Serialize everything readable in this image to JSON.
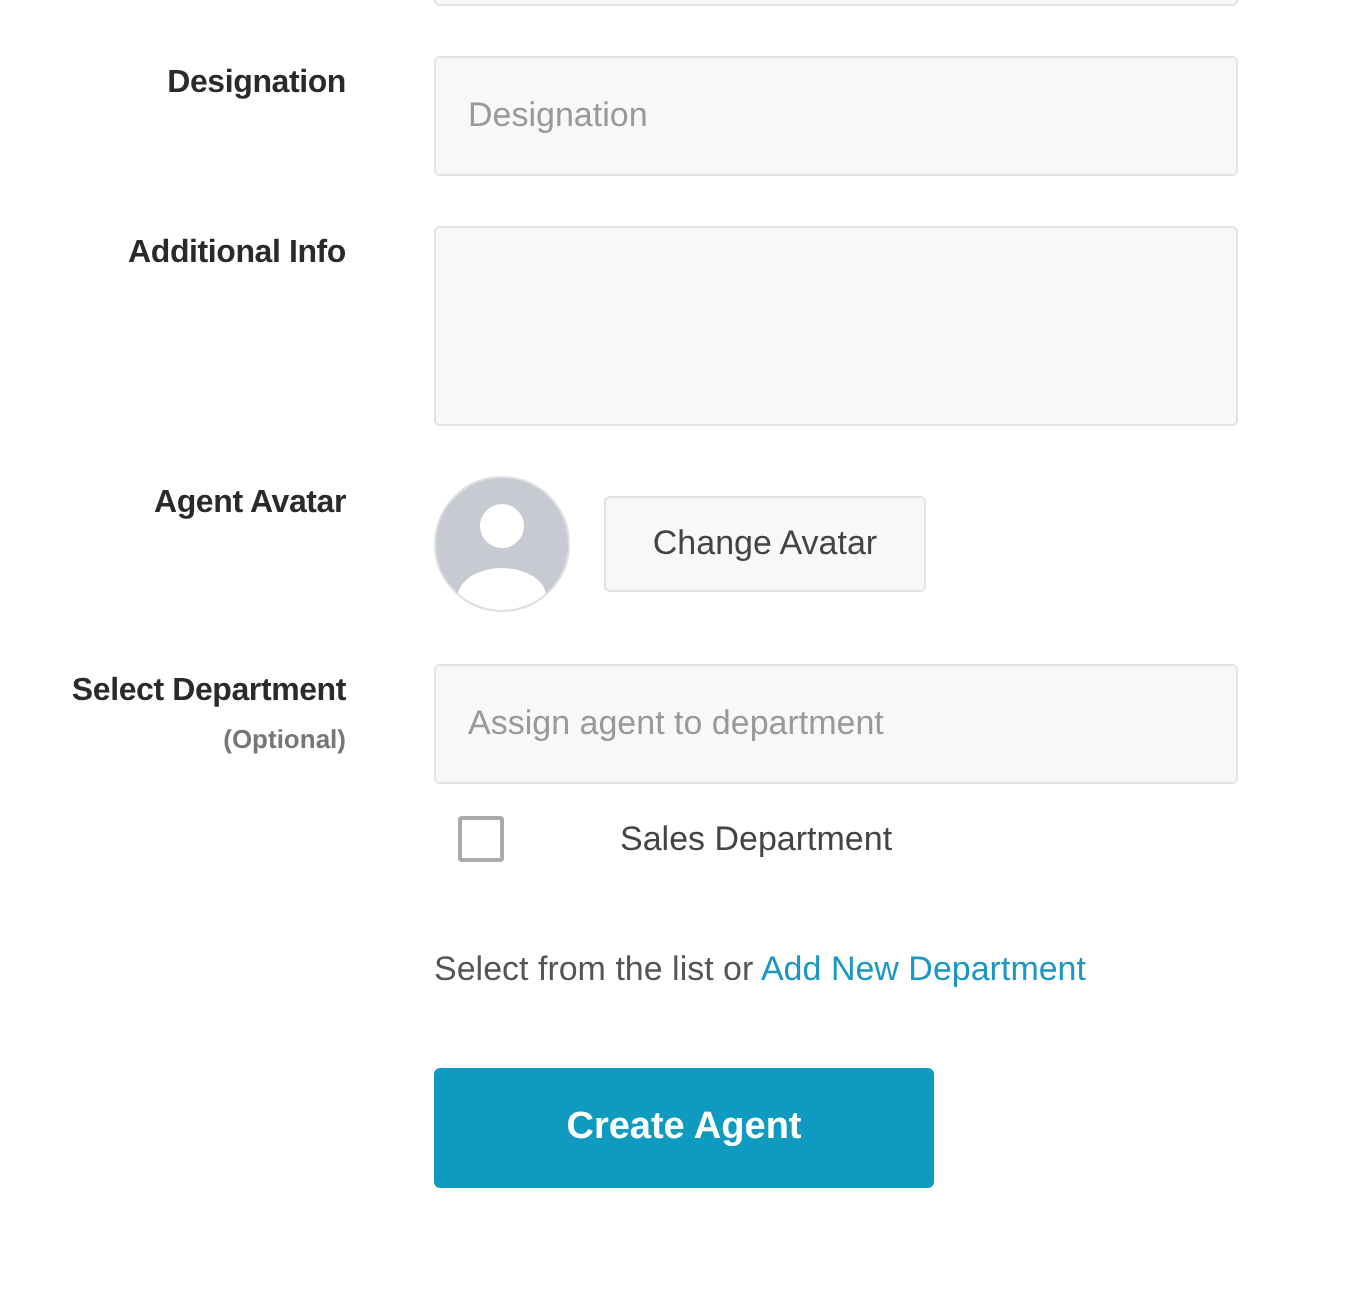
{
  "fields": [
    {
      "kind": "input",
      "label": "Designation",
      "placeholder": "Designation"
    },
    {
      "kind": "textarea",
      "label": "Additional Info"
    },
    {
      "kind": "avatar",
      "label": "Agent Avatar",
      "button": "Change Avatar"
    },
    {
      "kind": "department",
      "label": "Select Department",
      "note": "(Optional)",
      "placeholder": "Assign agent to department",
      "options": [
        {
          "label": "Sales Department",
          "checked": false
        }
      ],
      "helper": "Select from the list or",
      "link": "Add New Department"
    }
  ],
  "submit": "Create Agent"
}
